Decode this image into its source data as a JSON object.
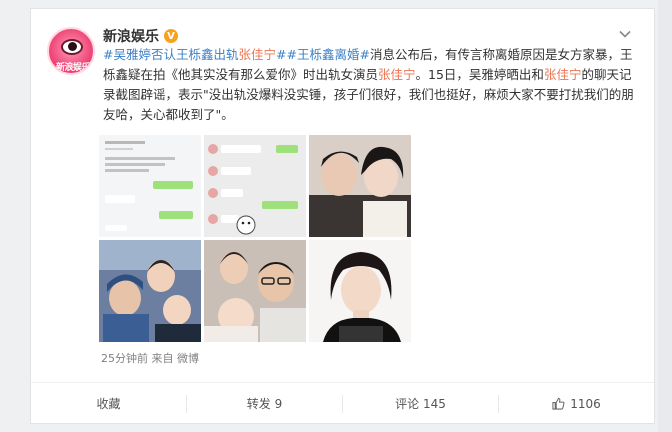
{
  "poster": {
    "name": "新浪娱乐",
    "verified_icon": "V",
    "avatar_text": "新浪娱乐"
  },
  "post": {
    "text_1_tag_a": "#吴雅婷否认王栎鑫出轨",
    "text_1_link_a": "张佳宁",
    "text_1_hash_end": "#",
    "text_1_tag_b": "#王栎鑫离婚#",
    "text_1_rest": "消息公布后，有传言称离婚原因是女方家暴，王栎鑫疑在拍《他其实没有那么爱你》时出轨女演员",
    "text_1_link_b": "张佳宁",
    "text_1_after_b": "。15日，吴雅婷晒出和",
    "text_1_link_c": "张佳宁",
    "text_1_tail": "的聊天记录截图辟谣，表示\"没出轨没爆料没实锤，孩子们很好，我们也挺好，麻烦大家不要打扰我们的朋友哈，关心都收到了\"。"
  },
  "images": [
    "chat-screenshot-1",
    "chat-screenshot-2",
    "couple-selfie",
    "family-photo-1",
    "family-photo-2",
    "portrait-photo"
  ],
  "meta": {
    "time": "25分钟前",
    "source": "来自 微博"
  },
  "actions": {
    "favorite": "收藏",
    "repost": "转发 9",
    "comment": "评论 145",
    "like": "1106"
  },
  "colors": {
    "link": "#eb7350",
    "hashtag": "#3b80c7",
    "verified": "#f7a21b"
  }
}
